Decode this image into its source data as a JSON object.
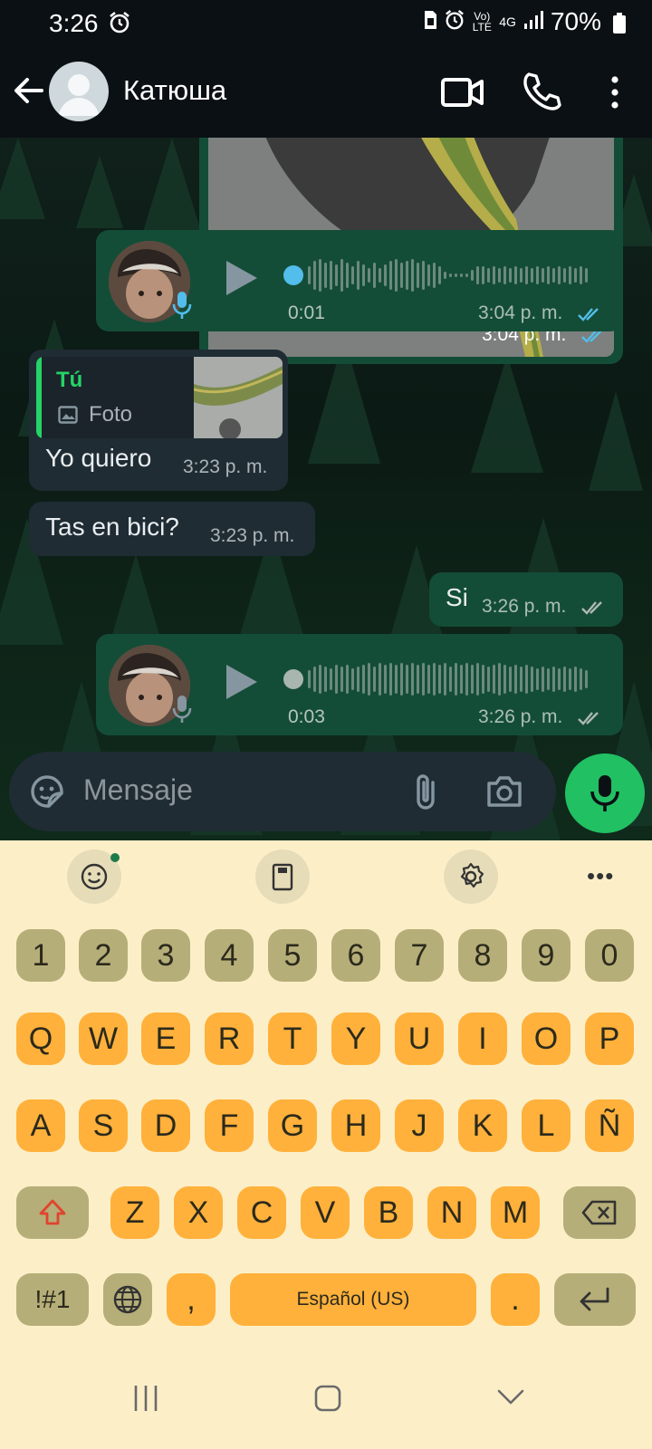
{
  "status_bar": {
    "time": "3:26",
    "network_top": "Vo) LTE",
    "network_type": "4G",
    "battery": "70%"
  },
  "header": {
    "contact_name": "Катюша"
  },
  "messages": {
    "photo_out": {
      "time": "3:04 p. m."
    },
    "voice_1": {
      "duration": "0:01",
      "time": "3:04 p. m."
    },
    "reply_in": {
      "quote_author": "Tú",
      "quote_type": "Foto",
      "text": "Yo quiero",
      "time": "3:23 p. m."
    },
    "text_in": {
      "text": "Tas en bici?",
      "time": "3:23 p. m."
    },
    "text_out": {
      "text": "Si",
      "time": "3:26 p. m."
    },
    "voice_2": {
      "duration": "0:03",
      "time": "3:26 p. m."
    }
  },
  "composer": {
    "placeholder": "Mensaje"
  },
  "keyboard": {
    "numbers": [
      "1",
      "2",
      "3",
      "4",
      "5",
      "6",
      "7",
      "8",
      "9",
      "0"
    ],
    "row1": [
      "Q",
      "W",
      "E",
      "R",
      "T",
      "Y",
      "U",
      "I",
      "O",
      "P"
    ],
    "row2": [
      "A",
      "S",
      "D",
      "F",
      "G",
      "H",
      "J",
      "K",
      "L",
      "Ñ"
    ],
    "row3": [
      "Z",
      "X",
      "C",
      "V",
      "B",
      "N",
      "M"
    ],
    "symbols_key": "!#1",
    "comma": ",",
    "space_label": "Español (US)",
    "period": "."
  },
  "colors": {
    "outgoing_bubble": "#144d37",
    "incoming_bubble": "#1f2c34",
    "accent_green": "#25d366",
    "read_tick_blue": "#53bdeb",
    "key_letter": "#ffb13b",
    "key_function": "#b6ae78",
    "keyboard_bg": "#fcefc8"
  }
}
